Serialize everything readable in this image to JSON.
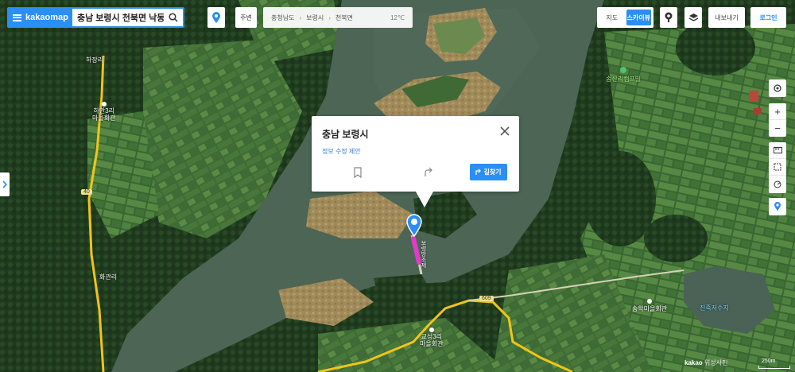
{
  "header": {
    "logo": "kakaomap",
    "search_value": "충남 보령시 천북면 낙동리",
    "location_chip": "주변",
    "breadcrumb": [
      "충청남도",
      "보령시",
      "천북면"
    ],
    "weather": "12℃"
  },
  "map_type": {
    "options": [
      "지도",
      "스카이뷰"
    ],
    "active": "스카이뷰"
  },
  "buttons": {
    "share": "내보내기",
    "login": "로그인",
    "route": "길찾기"
  },
  "popup": {
    "title": "충남 보령시",
    "subtitle": "정보 수정 제안"
  },
  "map_labels": {
    "hajang": "하장리",
    "hamyeon_hall_1": "하만3리",
    "hamyeon_hall_2": "마을회관",
    "hwagwanri": "화관리",
    "camping": "송산리캠프빌",
    "gyoseong_1": "교성3리",
    "gyoseong_2": "마을회관",
    "songhak": "송학마을회관",
    "jinjuk": "진죽저수지",
    "road_609": "609",
    "road_40": "40",
    "bridge": "보령방조제"
  },
  "footer": {
    "copyright": "kakao",
    "copyright_suffix": " 위성사진",
    "scale": "250m"
  },
  "colors": {
    "accent": "#2b8ef5",
    "road_yellow": "#f1c517",
    "route_pink": "#e03cc8"
  }
}
